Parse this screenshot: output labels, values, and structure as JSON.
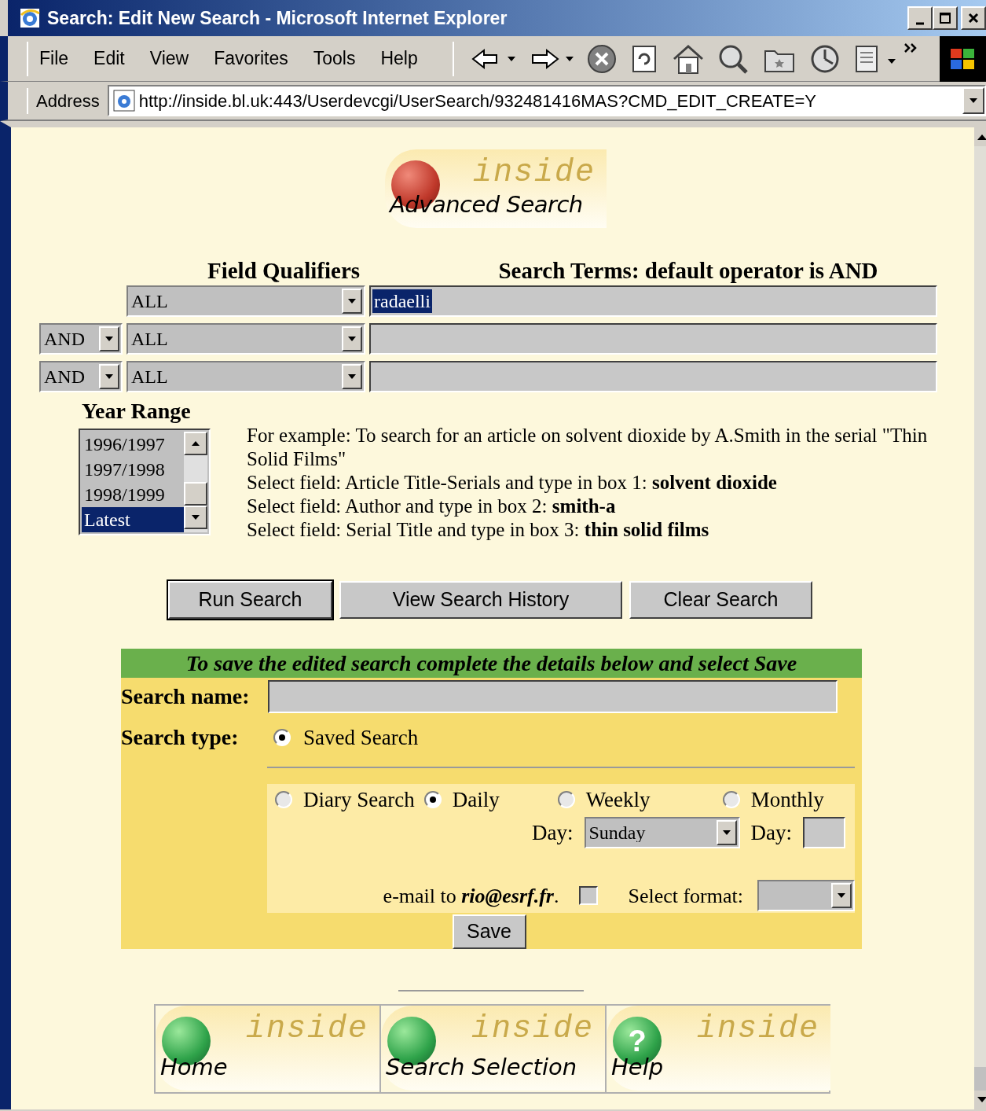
{
  "window": {
    "title": "Search: Edit New Search - Microsoft Internet Explorer"
  },
  "menu": [
    "File",
    "Edit",
    "View",
    "Favorites",
    "Tools",
    "Help"
  ],
  "address_bar": {
    "label": "Address",
    "url": "http://inside.bl.uk:443/Userdevcgi/UserSearch/932481416MAS?CMD_EDIT_CREATE=Y"
  },
  "logo": {
    "brand": "inside",
    "title": "Advanced Search"
  },
  "headers": {
    "qualifiers": "Field Qualifiers",
    "terms": "Search Terms: default operator is AND"
  },
  "query_rows": [
    {
      "qualifier": "ALL",
      "term": "radaelli",
      "term_selected": true
    },
    {
      "operator": "AND",
      "qualifier": "ALL"
    },
    {
      "operator": "AND",
      "qualifier": "ALL"
    }
  ],
  "year_range": {
    "label": "Year Range",
    "items": [
      {
        "label": "1996/1997",
        "selected": false
      },
      {
        "label": "1997/1998",
        "selected": false
      },
      {
        "label": "1998/1999",
        "selected": false
      },
      {
        "label": "Latest",
        "selected": true
      }
    ]
  },
  "example": [
    "For example: To search for an article on solvent dioxide by A.Smith in the serial \"Thin Solid Films\"",
    "Select field: Article Title-Serials and type in box 1: **solvent dioxide**",
    "Select field: Author and type in box 2: **smith-a**",
    "Select field: Serial Title and type in box 3: **thin solid films**"
  ],
  "buttons": [
    {
      "label": "Run Search",
      "default": true
    },
    {
      "label": "View Search History",
      "default": false
    },
    {
      "label": "Clear Search",
      "default": false
    }
  ],
  "save_panel": {
    "heading": "To save the edited search complete the details below and select Save",
    "name_label": "Search name:",
    "type_label": "Search type:",
    "saved_option": {
      "label": "Saved Search",
      "selected": true
    },
    "diary_option": {
      "label": "Diary Search",
      "selected": false
    },
    "frequencies": [
      {
        "label": "Daily",
        "selected": true
      },
      {
        "label": "Weekly",
        "selected": false
      },
      {
        "label": "Monthly",
        "selected": false
      }
    ],
    "weekly_day": {
      "label": "Day:",
      "value": "Sunday"
    },
    "monthly_day": {
      "label": "Day:"
    },
    "email": {
      "label": "e-mail to",
      "address": "rio@esrf.fr",
      "suffix": ".",
      "checked": false
    },
    "format": {
      "label": "Select format:"
    },
    "save_button": "Save"
  },
  "nav": [
    {
      "label": "Home",
      "brand": "inside",
      "kind": "ball"
    },
    {
      "label": "Search Selection",
      "brand": "inside",
      "kind": "ball"
    },
    {
      "label": "Help",
      "brand": "inside",
      "kind": "help",
      "glyph": "?"
    }
  ]
}
